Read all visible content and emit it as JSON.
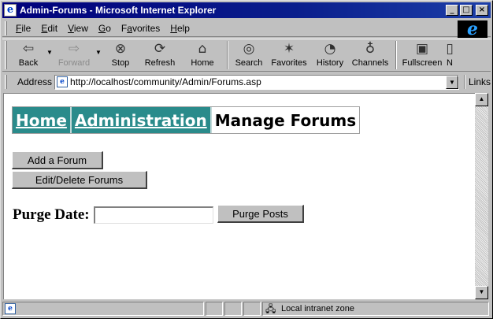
{
  "window": {
    "title": "Admin-Forums - Microsoft Internet Explorer",
    "controls": {
      "minimize": "_",
      "maximize": "□",
      "close": "×"
    }
  },
  "menu": [
    "File",
    "Edit",
    "View",
    "Go",
    "Favorites",
    "Help"
  ],
  "menu_mnemonics": [
    "F",
    "E",
    "V",
    "G",
    "a",
    "H"
  ],
  "toolbar": {
    "back": "Back",
    "forward": "Forward",
    "stop": "Stop",
    "refresh": "Refresh",
    "home": "Home",
    "search": "Search",
    "favorites": "Favorites",
    "history": "History",
    "channels": "Channels",
    "fullscreen": "Fullscreen",
    "more": "N"
  },
  "address": {
    "label": "Address",
    "url": "http://localhost/community/Admin/Forums.asp",
    "links": "Links"
  },
  "page": {
    "breadcrumbs": {
      "home": "Home",
      "admin": "Administration",
      "current": "Manage Forums"
    },
    "buttons": {
      "add_forum": "Add a Forum",
      "edit_delete": "Edit/Delete Forums",
      "purge": "Purge Posts"
    },
    "purge_label": "Purge Date:",
    "purge_value": ""
  },
  "status": {
    "zone": "Local intranet zone"
  },
  "colors": {
    "breadcrumb_link_bg": "#2a8b8b",
    "titlebar": "#00007b"
  }
}
